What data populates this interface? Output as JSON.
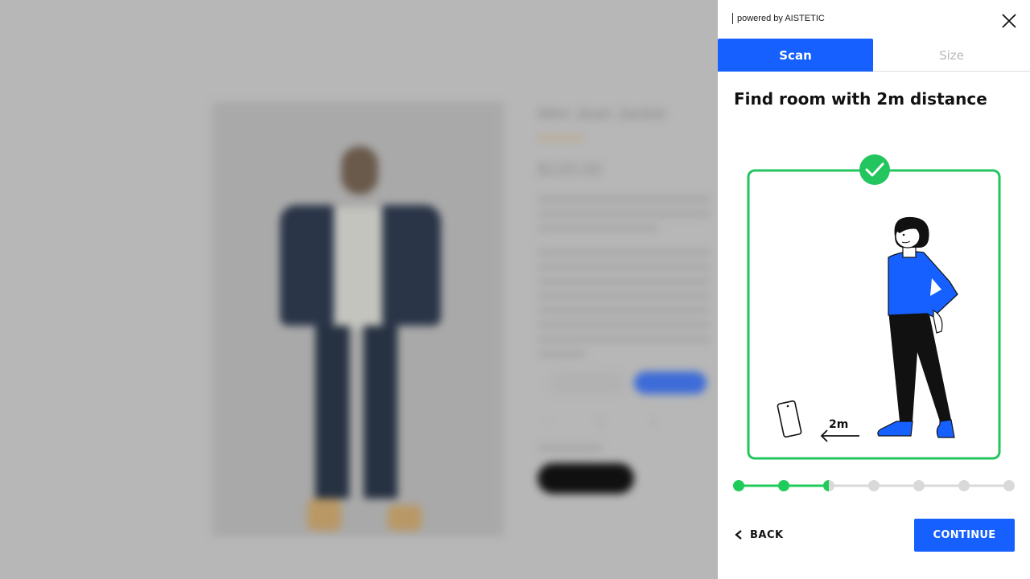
{
  "background_page": {
    "product_title": "Men Jean Jacket",
    "rating_stars": "★★★★★",
    "price": "$120.00"
  },
  "panel": {
    "powered_by": "powered by AISTETIC",
    "tabs": [
      {
        "label": "Scan",
        "active": true
      },
      {
        "label": "Size",
        "active": false
      }
    ],
    "step_title": "Find room with 2m distance",
    "illustration": {
      "distance_label": "2m",
      "frame_color": "#22c55e",
      "check_color": "#22c55e"
    },
    "progress": {
      "total_steps": 7,
      "completed_steps": 2,
      "current_step": 3,
      "active_color": "#1fcc5a",
      "inactive_color": "#d9d9d9"
    },
    "back_label": "BACK",
    "continue_label": "CONTINUE",
    "accent_color": "#1560ff"
  }
}
